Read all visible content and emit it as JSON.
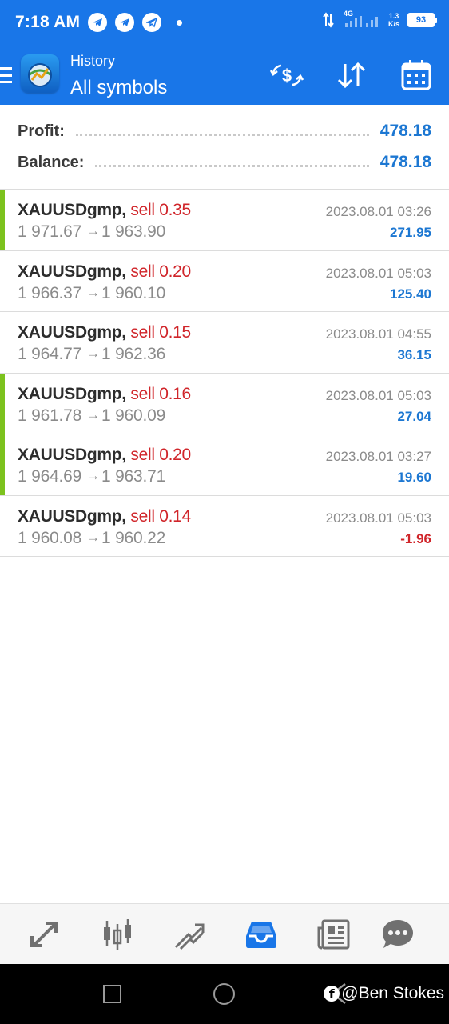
{
  "status_bar": {
    "time": "7:18 AM",
    "network": "4G",
    "speed_value": "1.3",
    "speed_unit": "K/s",
    "battery": "93",
    "icons": [
      "telegram-icon",
      "telegram-icon",
      "telegram-x-icon",
      "notification-dot"
    ]
  },
  "header": {
    "subtitle": "History",
    "title": "All symbols",
    "actions": [
      "dollar-swap-icon",
      "sort-icon",
      "calendar-icon"
    ]
  },
  "summary": {
    "profit_label": "Profit:",
    "profit_value": "478.18",
    "balance_label": "Balance:",
    "balance_value": "478.18"
  },
  "deals": [
    {
      "symbol": "XAUUSDgmp,",
      "side": "sell 0.35",
      "open": "1 971.67",
      "close": "1 963.90",
      "time": "2023.08.01 03:26",
      "profit": "271.95",
      "marked": true,
      "negative": false
    },
    {
      "symbol": "XAUUSDgmp,",
      "side": "sell 0.20",
      "open": "1 966.37",
      "close": "1 960.10",
      "time": "2023.08.01 05:03",
      "profit": "125.40",
      "marked": false,
      "negative": false
    },
    {
      "symbol": "XAUUSDgmp,",
      "side": "sell 0.15",
      "open": "1 964.77",
      "close": "1 962.36",
      "time": "2023.08.01 04:55",
      "profit": "36.15",
      "marked": false,
      "negative": false
    },
    {
      "symbol": "XAUUSDgmp,",
      "side": "sell 0.16",
      "open": "1 961.78",
      "close": "1 960.09",
      "time": "2023.08.01 05:03",
      "profit": "27.04",
      "marked": true,
      "negative": false
    },
    {
      "symbol": "XAUUSDgmp,",
      "side": "sell 0.20",
      "open": "1 964.69",
      "close": "1 963.71",
      "time": "2023.08.01 03:27",
      "profit": "19.60",
      "marked": true,
      "negative": false
    },
    {
      "symbol": "XAUUSDgmp,",
      "side": "sell 0.14",
      "open": "1 960.08",
      "close": "1 960.22",
      "time": "2023.08.01 05:03",
      "profit": "-1.96",
      "marked": false,
      "negative": true
    }
  ],
  "bottom_nav": [
    {
      "icon": "quotes-icon",
      "active": false
    },
    {
      "icon": "chart-icon",
      "active": false
    },
    {
      "icon": "trade-icon",
      "active": false
    },
    {
      "icon": "history-icon",
      "active": true
    },
    {
      "icon": "news-icon",
      "active": false
    },
    {
      "icon": "chat-icon",
      "active": false
    }
  ],
  "watermark": "@Ben Stokes",
  "colors": {
    "accent": "#1976e8",
    "profit_blue": "#1c77d2",
    "sell_red": "#d0252a",
    "marker_green": "#7cc21e"
  }
}
